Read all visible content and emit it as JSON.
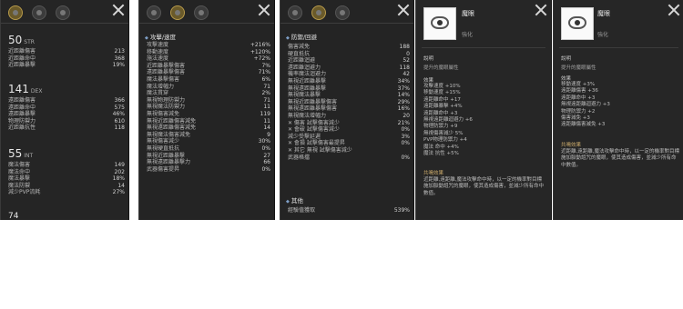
{
  "panel1": {
    "sections": [
      {
        "value": "50",
        "abbr": "STR",
        "rows": [
          {
            "label": "近距離傷害",
            "value": "213"
          },
          {
            "label": "近距離命中",
            "value": "368"
          },
          {
            "label": "近距離暴擊",
            "value": "19%"
          }
        ]
      },
      {
        "value": "141",
        "abbr": "DEX",
        "rows": [
          {
            "label": "遠距離傷害",
            "value": "366"
          },
          {
            "label": "遠距離命中",
            "value": "575"
          },
          {
            "label": "遠距離暴擊",
            "value": "46%"
          },
          {
            "label": "物理防禦力",
            "value": "610"
          },
          {
            "label": "近距離抗性",
            "value": "118"
          }
        ]
      },
      {
        "value": "55",
        "abbr": "INT",
        "rows": [
          {
            "label": "魔法傷害",
            "value": "149"
          },
          {
            "label": "魔法命中",
            "value": "202"
          },
          {
            "label": "魔法暴擊",
            "value": "18%"
          },
          {
            "label": "魔法防禦",
            "value": "14"
          },
          {
            "label": "減少PVP流耗",
            "value": "27%"
          }
        ]
      }
    ],
    "footer": "74"
  },
  "panel2": {
    "section_title": "攻擊/速度",
    "rows": [
      {
        "label": "攻擊速度",
        "value": "+216%"
      },
      {
        "label": "移動速度",
        "value": "+120%"
      },
      {
        "label": "施法速度",
        "value": "+72%"
      },
      {
        "label": "近距離暴擊傷害",
        "value": "7%"
      },
      {
        "label": "遠距離暴擊傷害",
        "value": "71%"
      },
      {
        "label": "魔法暴擊傷害",
        "value": "6%"
      },
      {
        "label": "魔法增幅力",
        "value": "71"
      },
      {
        "label": "魔法貫穿",
        "value": "2%"
      },
      {
        "label": "無視物理防禦力",
        "value": "71"
      },
      {
        "label": "無視魔法防禦力",
        "value": "11"
      },
      {
        "label": "無視傷害減免",
        "value": "119"
      },
      {
        "label": "無視近距離傷害減免",
        "value": "11"
      },
      {
        "label": "無視遠距離傷害減免",
        "value": "14"
      },
      {
        "label": "無視魔法傷害減免",
        "value": "9"
      },
      {
        "label": "無視傷害減少",
        "value": "30%"
      },
      {
        "label": "無視硬直抵抗",
        "value": "0%"
      },
      {
        "label": "無視近距離暴擊",
        "value": "27"
      },
      {
        "label": "無視遠距離暴擊力",
        "value": "66"
      },
      {
        "label": "武器傷害提昇",
        "value": "0%"
      }
    ]
  },
  "panel3": {
    "section_title": "防禦/回避",
    "rows": [
      {
        "label": "傷害減免",
        "value": "188"
      },
      {
        "label": "硬直抵抗",
        "value": "0"
      },
      {
        "label": "近距離迴避",
        "value": "52"
      },
      {
        "label": "遠距離迴避力",
        "value": "118"
      },
      {
        "label": "機率魔法迴避力",
        "value": "42"
      },
      {
        "label": "無視近距離暴擊",
        "value": "34%"
      },
      {
        "label": "無視遠距離暴擊",
        "value": "37%"
      },
      {
        "label": "無視魔法暴擊",
        "value": "14%"
      },
      {
        "label": "無視近距離暴擊傷害",
        "value": "29%"
      },
      {
        "label": "無視遠距離暴擊傷害",
        "value": "16%"
      },
      {
        "label": "無視魔法增幅力",
        "value": "20"
      },
      {
        "label": "✕ 傷害 試擊傷害減少",
        "value": "21%"
      },
      {
        "label": "✕ 會破 試擊傷害減少",
        "value": "0%"
      },
      {
        "label": "減少受擊延遲",
        "value": "3%"
      },
      {
        "label": "✕ 會損 試擊傷害最提昇",
        "value": "0%"
      },
      {
        "label": "✕ 其它 無視 試擊傷害減少",
        "value": ""
      },
      {
        "label": "武器格擋",
        "value": "0%"
      }
    ],
    "other_title": "其他",
    "other_rows": [
      {
        "label": "經驗值獲取",
        "value": "539%"
      }
    ]
  },
  "panel4": {
    "name": "魔眼",
    "sub": "強化",
    "desc_title": "說明",
    "desc": "提升的魔眼屬性",
    "effect_title": "效果",
    "effects": [
      "攻擊速度 +10%",
      "移動速度 +15%",
      "遠距離命中 +17",
      "遠距離暴擊 +4%",
      "遠距離命中 +3",
      "無視遠距離迴避力 +6",
      "物理防禦力 +9",
      "無視傷害減少 5%",
      "PVP物理防禦力 +4",
      "魔法 命中 +4%",
      "魔法 抗性 +5%"
    ],
    "set_title": "共鳴效果",
    "set_desc": "近距離,遠距離,魔法攻擊命中時，以一定的機率對目標施加脈動詛咒的魔眼，使其造成傷害，並減少所有命中數值。"
  },
  "panel5": {
    "name": "魔眼",
    "sub": "強化",
    "desc_title": "說明",
    "desc": "提升的魔眼屬性",
    "effect_title": "效果",
    "effects": [
      "移動速度 +3%",
      "遠距離傷害 +36",
      "遠距離命中 +3",
      "無視遠距離迴避力 +3",
      "物理防禦力 +2",
      "傷害減免 +3",
      "遠距離傷害減免 +3"
    ],
    "set_title": "共鳴效果",
    "set_desc": "近距離,遠距離,魔法攻擊命中時，以一定的機率對目標施加脈動詛咒的魔眼，使其造成傷害，並減少所有命中數值。"
  }
}
